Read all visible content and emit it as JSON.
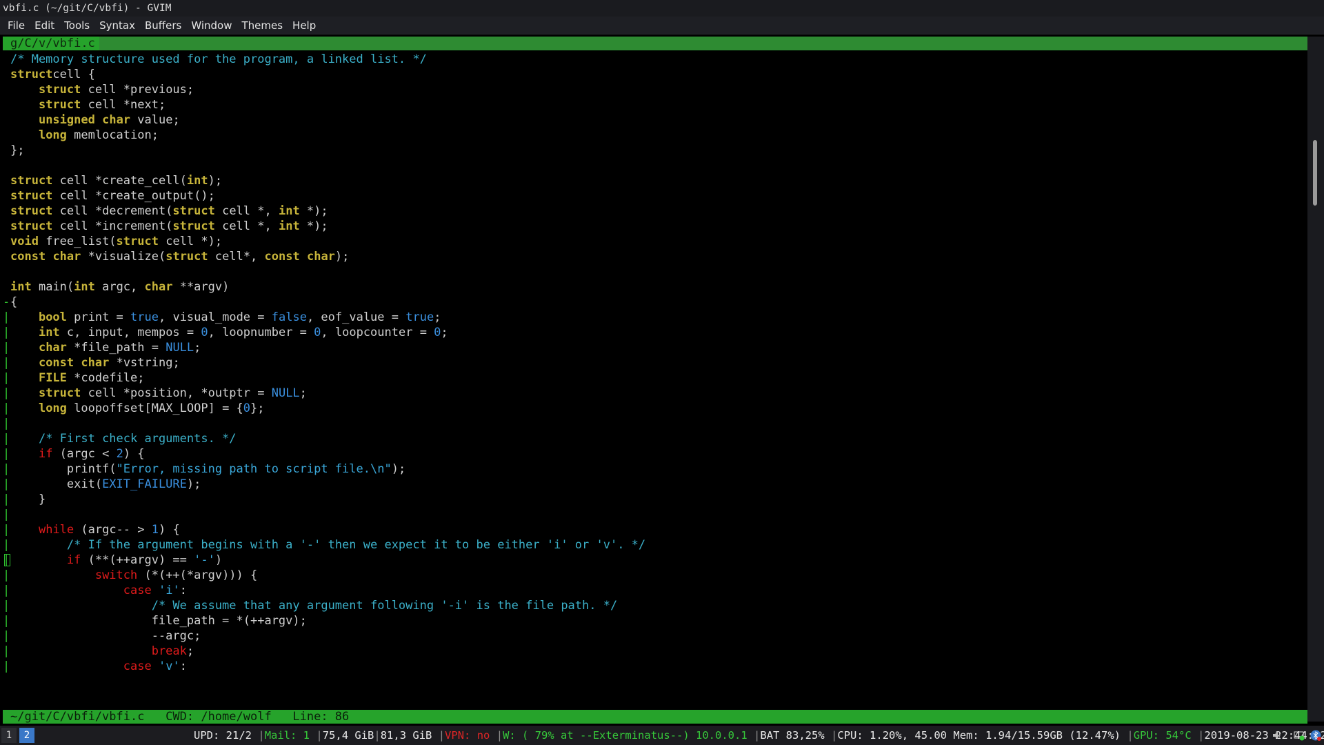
{
  "window": {
    "title": "vbfi.c (~/git/C/vbfi) - GVIM"
  },
  "menu": [
    "File",
    "Edit",
    "Tools",
    "Syntax",
    "Buffers",
    "Window",
    "Themes",
    "Help"
  ],
  "tab": {
    "label": "g/C/v/vbfi.c"
  },
  "code_lines": [
    {
      "fold": "",
      "tokens": [
        [
          "cm",
          "/* Memory structure used for the program, a linked list. */"
        ]
      ]
    },
    {
      "fold": "",
      "tokens": [
        [
          "st",
          "struct"
        ],
        [
          "",
          "cell {"
        ]
      ]
    },
    {
      "fold": "",
      "tokens": [
        [
          "",
          "    "
        ],
        [
          "st",
          "struct"
        ],
        [
          "",
          " cell *previous;"
        ]
      ]
    },
    {
      "fold": "",
      "tokens": [
        [
          "",
          "    "
        ],
        [
          "st",
          "struct"
        ],
        [
          "",
          " cell *next;"
        ]
      ]
    },
    {
      "fold": "",
      "tokens": [
        [
          "",
          "    "
        ],
        [
          "ty",
          "unsigned"
        ],
        [
          "",
          " "
        ],
        [
          "ty",
          "char"
        ],
        [
          "",
          " value;"
        ]
      ]
    },
    {
      "fold": "",
      "tokens": [
        [
          "",
          "    "
        ],
        [
          "ty",
          "long"
        ],
        [
          "",
          " memlocation;"
        ]
      ]
    },
    {
      "fold": "",
      "tokens": [
        [
          "",
          "};"
        ]
      ]
    },
    {
      "fold": "",
      "tokens": []
    },
    {
      "fold": "",
      "tokens": [
        [
          "st",
          "struct"
        ],
        [
          "",
          " cell *create_cell("
        ],
        [
          "ty",
          "int"
        ],
        [
          "",
          ");"
        ]
      ]
    },
    {
      "fold": "",
      "tokens": [
        [
          "st",
          "struct"
        ],
        [
          "",
          " cell *create_output();"
        ]
      ]
    },
    {
      "fold": "",
      "tokens": [
        [
          "st",
          "struct"
        ],
        [
          "",
          " cell *decrement("
        ],
        [
          "st",
          "struct"
        ],
        [
          "",
          " cell *, "
        ],
        [
          "ty",
          "int"
        ],
        [
          "",
          " *);"
        ]
      ]
    },
    {
      "fold": "",
      "tokens": [
        [
          "st",
          "struct"
        ],
        [
          "",
          " cell *increment("
        ],
        [
          "st",
          "struct"
        ],
        [
          "",
          " cell *, "
        ],
        [
          "ty",
          "int"
        ],
        [
          "",
          " *);"
        ]
      ]
    },
    {
      "fold": "",
      "tokens": [
        [
          "ty",
          "void"
        ],
        [
          "",
          " free_list("
        ],
        [
          "st",
          "struct"
        ],
        [
          "",
          " cell *);"
        ]
      ]
    },
    {
      "fold": "",
      "tokens": [
        [
          "ty",
          "const"
        ],
        [
          "",
          " "
        ],
        [
          "ty",
          "char"
        ],
        [
          "",
          " *visualize("
        ],
        [
          "st",
          "struct"
        ],
        [
          "",
          " cell*, "
        ],
        [
          "ty",
          "const"
        ],
        [
          "",
          " "
        ],
        [
          "ty",
          "char"
        ],
        [
          "",
          ");"
        ]
      ]
    },
    {
      "fold": "",
      "tokens": []
    },
    {
      "fold": "",
      "tokens": [
        [
          "ty",
          "int"
        ],
        [
          "",
          " main("
        ],
        [
          "ty",
          "int"
        ],
        [
          "",
          " argc, "
        ],
        [
          "ty",
          "char"
        ],
        [
          "",
          " **argv)"
        ]
      ]
    },
    {
      "fold": "-",
      "tokens": [
        [
          "",
          "{"
        ]
      ]
    },
    {
      "fold": "|",
      "tokens": [
        [
          "",
          "    "
        ],
        [
          "ty",
          "bool"
        ],
        [
          "",
          " print = "
        ],
        [
          "cn",
          "true"
        ],
        [
          "",
          ", visual_mode = "
        ],
        [
          "cn",
          "false"
        ],
        [
          "",
          ", eof_value = "
        ],
        [
          "cn",
          "true"
        ],
        [
          "",
          ";"
        ]
      ]
    },
    {
      "fold": "|",
      "tokens": [
        [
          "",
          "    "
        ],
        [
          "ty",
          "int"
        ],
        [
          "",
          " c, input, mempos = "
        ],
        [
          "cn",
          "0"
        ],
        [
          "",
          ", loopnumber = "
        ],
        [
          "cn",
          "0"
        ],
        [
          "",
          ", loopcounter = "
        ],
        [
          "cn",
          "0"
        ],
        [
          "",
          ";"
        ]
      ]
    },
    {
      "fold": "|",
      "tokens": [
        [
          "",
          "    "
        ],
        [
          "ty",
          "char"
        ],
        [
          "",
          " *file_path = "
        ],
        [
          "cn",
          "NULL"
        ],
        [
          "",
          ";"
        ]
      ]
    },
    {
      "fold": "|",
      "tokens": [
        [
          "",
          "    "
        ],
        [
          "ty",
          "const"
        ],
        [
          "",
          " "
        ],
        [
          "ty",
          "char"
        ],
        [
          "",
          " *vstring;"
        ]
      ]
    },
    {
      "fold": "|",
      "tokens": [
        [
          "",
          "    "
        ],
        [
          "ty",
          "FILE"
        ],
        [
          "",
          " *codefile;"
        ]
      ]
    },
    {
      "fold": "|",
      "tokens": [
        [
          "",
          "    "
        ],
        [
          "st",
          "struct"
        ],
        [
          "",
          " cell *position, *outptr = "
        ],
        [
          "cn",
          "NULL"
        ],
        [
          "",
          ";"
        ]
      ]
    },
    {
      "fold": "|",
      "tokens": [
        [
          "",
          "    "
        ],
        [
          "ty",
          "long"
        ],
        [
          "",
          " loopoffset[MAX_LOOP] = {"
        ],
        [
          "cn",
          "0"
        ],
        [
          "",
          "};"
        ]
      ]
    },
    {
      "fold": "|",
      "tokens": []
    },
    {
      "fold": "|",
      "tokens": [
        [
          "",
          "    "
        ],
        [
          "cm",
          "/* First check arguments. */"
        ]
      ]
    },
    {
      "fold": "|",
      "tokens": [
        [
          "",
          "    "
        ],
        [
          "kw",
          "if"
        ],
        [
          "",
          " (argc < "
        ],
        [
          "cn",
          "2"
        ],
        [
          "",
          ") {"
        ]
      ]
    },
    {
      "fold": "|",
      "tokens": [
        [
          "",
          "        printf("
        ],
        [
          "str",
          "\"Error, missing path to script file.\\n\""
        ],
        [
          "",
          ");"
        ]
      ]
    },
    {
      "fold": "|",
      "tokens": [
        [
          "",
          "        exit("
        ],
        [
          "cn",
          "EXIT_FAILURE"
        ],
        [
          "",
          ");"
        ]
      ]
    },
    {
      "fold": "|",
      "tokens": [
        [
          "",
          "    }"
        ]
      ]
    },
    {
      "fold": "|",
      "tokens": []
    },
    {
      "fold": "|",
      "tokens": [
        [
          "",
          "    "
        ],
        [
          "kw",
          "while"
        ],
        [
          "",
          " (argc-- > "
        ],
        [
          "cn",
          "1"
        ],
        [
          "",
          ") {"
        ]
      ]
    },
    {
      "fold": "|",
      "tokens": [
        [
          "",
          "        "
        ],
        [
          "cm",
          "/* If the argument begins with a '-' then we expect it to be either 'i' or 'v'. */"
        ]
      ]
    },
    {
      "fold": "|",
      "cursor": true,
      "tokens": [
        [
          "",
          "        "
        ],
        [
          "kw",
          "if"
        ],
        [
          "",
          " (**(++argv) == "
        ],
        [
          "str",
          "'-'"
        ],
        [
          "",
          ")"
        ]
      ]
    },
    {
      "fold": "|",
      "tokens": [
        [
          "",
          "            "
        ],
        [
          "kw",
          "switch"
        ],
        [
          "",
          " (*(++(*argv))) {"
        ]
      ]
    },
    {
      "fold": "|",
      "tokens": [
        [
          "",
          "                "
        ],
        [
          "kw",
          "case"
        ],
        [
          "",
          " "
        ],
        [
          "str",
          "'i'"
        ],
        [
          "",
          ":"
        ]
      ]
    },
    {
      "fold": "|",
      "tokens": [
        [
          "",
          "                    "
        ],
        [
          "cm",
          "/* We assume that any argument following '-i' is the file path. */"
        ]
      ]
    },
    {
      "fold": "|",
      "tokens": [
        [
          "",
          "                    file_path = *(++argv);"
        ]
      ]
    },
    {
      "fold": "|",
      "tokens": [
        [
          "",
          "                    --argc;"
        ]
      ]
    },
    {
      "fold": "|",
      "tokens": [
        [
          "",
          "                    "
        ],
        [
          "kw",
          "break"
        ],
        [
          "",
          ";"
        ]
      ]
    },
    {
      "fold": "|",
      "tokens": [
        [
          "",
          "                "
        ],
        [
          "kw",
          "case"
        ],
        [
          "",
          " "
        ],
        [
          "str",
          "'v'"
        ],
        [
          "",
          ":"
        ]
      ]
    }
  ],
  "statusline": {
    "text": "~/git/C/vbfi/vbfi.c   CWD: /home/wolf   Line: 86"
  },
  "panel": {
    "workspaces": [
      "1",
      "2"
    ],
    "updates": "UPD: 21/2",
    "mail": "Mail: 1",
    "disk1": "75,4 GiB",
    "disk2": "81,3 GiB",
    "vpn": "VPN: no",
    "wifi": "W: ( 79% at --Exterminatus--) 10.0.0.1",
    "battery": "BAT 83,25%",
    "cpu": "CPU: 1.20%, 45.00",
    "mem": "Mem: 1.94/15.59GB (12.47%)",
    "gpu": "GPU: 54°C",
    "datetime": "2019-08-23 22:44:12"
  },
  "tray_icons": [
    "volume-icon",
    "network-icon",
    "bluetooth-icon"
  ]
}
